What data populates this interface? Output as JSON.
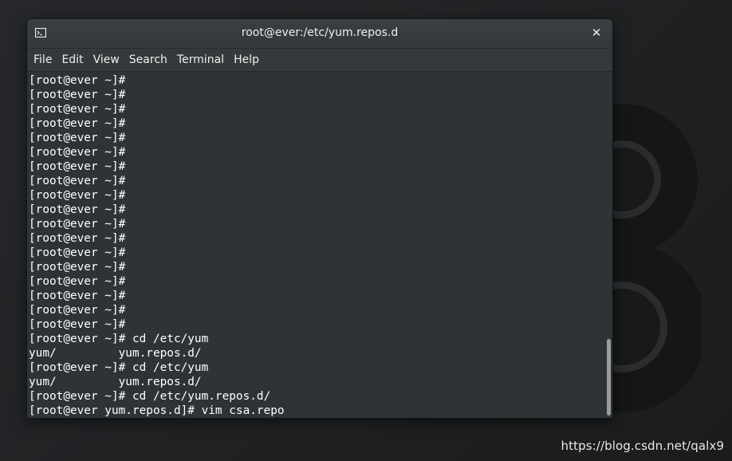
{
  "window": {
    "title": "root@ever:/etc/yum.repos.d",
    "close_glyph": "✕",
    "icon": "terminal-icon"
  },
  "menubar": {
    "items": [
      "File",
      "Edit",
      "View",
      "Search",
      "Terminal",
      "Help"
    ]
  },
  "terminal": {
    "lines": [
      "[root@ever ~]#",
      "[root@ever ~]#",
      "[root@ever ~]#",
      "[root@ever ~]#",
      "[root@ever ~]#",
      "[root@ever ~]#",
      "[root@ever ~]#",
      "[root@ever ~]#",
      "[root@ever ~]#",
      "[root@ever ~]#",
      "[root@ever ~]#",
      "[root@ever ~]#",
      "[root@ever ~]#",
      "[root@ever ~]#",
      "[root@ever ~]#",
      "[root@ever ~]#",
      "[root@ever ~]#",
      "[root@ever ~]#",
      "[root@ever ~]# cd /etc/yum",
      "yum/         yum.repos.d/",
      "[root@ever ~]# cd /etc/yum",
      "yum/         yum.repos.d/",
      "[root@ever ~]# cd /etc/yum.repos.d/",
      "[root@ever yum.repos.d]# vim csa.repo"
    ]
  },
  "watermark": "https://blog.csdn.net/qalx9",
  "colors": {
    "terminal_bg": "#2e3436",
    "terminal_fg": "#ffffff",
    "desktop_bg": "#1f2123"
  }
}
